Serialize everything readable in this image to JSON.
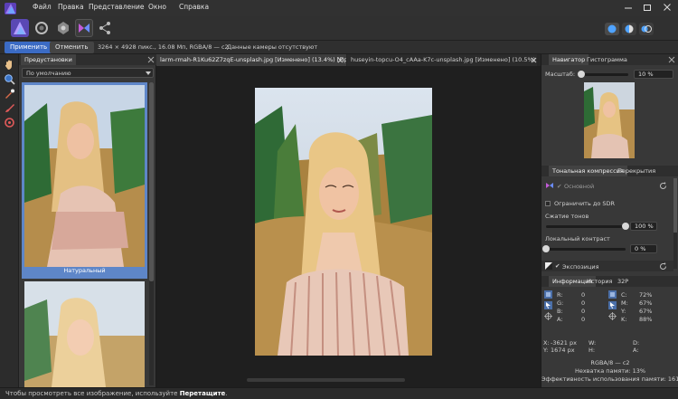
{
  "menu": [
    "Файл",
    "Правка",
    "Представление",
    "Окно",
    "Справка"
  ],
  "context": {
    "apply_label": "Применить",
    "cancel_label": "Отменить",
    "image_info": "3264 × 4928 пикс., 16.08 Мп, RGBA/8 — c2",
    "camera_info": "Данные камеры отсутствуют"
  },
  "presets": {
    "tab_label": "Предустановки",
    "dropdown_value": "По умолчанию",
    "items": [
      {
        "label": "Натуральный"
      },
      {
        "label": ""
      }
    ]
  },
  "doc_tabs": [
    {
      "label": "larm-rmah-R1Ku62Z7zqE-unsplash.jpg [Изменено] (13.4%) [Проб..."
    },
    {
      "label": "huseyin-topcu-O4_cAAa-K7c-unsplash.jpg [Изменено] (10.5%) [П..."
    }
  ],
  "navigator": {
    "tabs": [
      "Навигатор",
      "Гистограмма"
    ],
    "zoom_label": "Масштаб:",
    "zoom_value": "10 %",
    "zoom_fraction": 0.08
  },
  "adjustments": {
    "tabs": [
      "Тональная компрессия",
      "Перекрытия"
    ],
    "layer_name": "Основной",
    "clamp_sdr_label": "Ограничить до SDR",
    "tone_compression_label": "Сжатие тонов",
    "tone_compression_value": "100 %",
    "tone_compression_fraction": 1.0,
    "local_contrast_label": "Локальный контраст",
    "local_contrast_value": "0 %",
    "local_contrast_fraction": 0.0,
    "exposure_label": "Экспозиция"
  },
  "info": {
    "tabs": [
      "Информация",
      "История",
      "32P"
    ],
    "left": [
      {
        "k": "R:",
        "v": "0"
      },
      {
        "k": "G:",
        "v": "0"
      },
      {
        "k": "B:",
        "v": "0"
      },
      {
        "k": "A:",
        "v": "0"
      }
    ],
    "right": [
      {
        "k": "C:",
        "v": "72%"
      },
      {
        "k": "M:",
        "v": "67%"
      },
      {
        "k": "Y:",
        "v": "67%"
      },
      {
        "k": "K:",
        "v": "88%"
      }
    ],
    "x_label": "X:",
    "x_value": "-3621 px",
    "y_label": "Y:",
    "y_value": "1674 px",
    "w_label": "W:",
    "h_label": "H:",
    "d_label": "D:",
    "a_label": "A:",
    "format": "RGBA/8 — c2",
    "memory_shortage": "Нехватка памяти: 13%",
    "memory_efficiency": "Эффективность использования памяти: 161%"
  },
  "status": {
    "hint_prefix": "Чтобы просмотреть все изображение, используйте ",
    "hint_action": "Перетащите",
    "hint_suffix": "."
  },
  "colors": {
    "accent": "#4a73b8",
    "apply_bg": "#3b6bc4",
    "selection": "#5e86c8",
    "brand_purple": "#7b5bd6"
  }
}
